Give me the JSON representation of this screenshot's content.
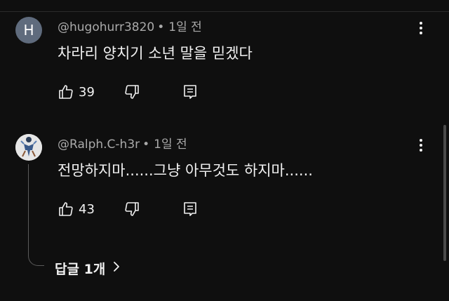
{
  "comments": [
    {
      "avatar_letter": "H",
      "avatar_color": "#5f6b7d",
      "author": "@hugohurr3820",
      "time": "1일 전",
      "text": "차라리 양치기 소년 말을 믿겠다",
      "likes": "39"
    },
    {
      "avatar_icon": "figure-avatar",
      "author": "@Ralph.C-h3r",
      "time": "1일 전",
      "text": "전망하지마......그냥 아무것도 하지마......",
      "likes": "43"
    }
  ],
  "replies_toggle": {
    "label": "답글 1개"
  },
  "icons": {
    "like": "thumbs-up-icon",
    "dislike": "thumbs-down-icon",
    "reply": "reply-icon",
    "more": "more-vertical-icon",
    "chevron": "chevron-right-icon"
  },
  "colors": {
    "background": "#0f0f0f",
    "text_primary": "#f1f1f1",
    "text_secondary": "#aaaaaa"
  }
}
